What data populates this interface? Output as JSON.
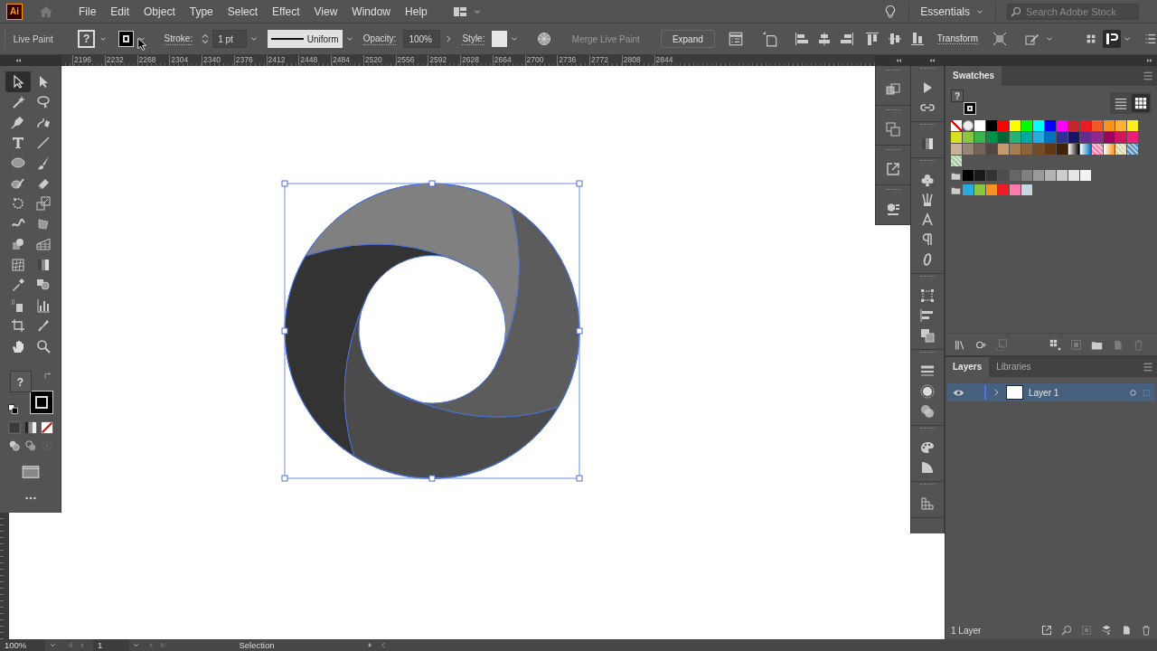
{
  "app_logo": "Ai",
  "menu": [
    "File",
    "Edit",
    "Object",
    "Type",
    "Select",
    "Effect",
    "View",
    "Window",
    "Help"
  ],
  "workspace": {
    "name": "Essentials"
  },
  "search": {
    "placeholder": "Search Adobe Stock"
  },
  "control_bar": {
    "mode": "Live Paint",
    "fill_label": "?",
    "stroke_label": "Stroke:",
    "stroke_weight": "1 pt",
    "stroke_profile": "Uniform",
    "opacity_label": "Opacity:",
    "opacity": "100%",
    "style_label": "Style:",
    "transform": "Transform",
    "buttons": [
      {
        "label": "Merge Live Paint",
        "disabled": true
      },
      {
        "label": "Expand",
        "disabled": false
      }
    ]
  },
  "ruler": {
    "ticks": [
      "2196",
      "2232",
      "2268",
      "2304",
      "2340",
      "2376",
      "2412",
      "2448",
      "2484",
      "2520",
      "2556",
      "2592",
      "2628",
      "2664",
      "2700",
      "2736",
      "2772",
      "2808",
      "2844"
    ]
  },
  "toolbar": {
    "fill_label": "?",
    "tools": [
      {
        "kind": "arrow",
        "selected": true
      },
      {
        "kind": "arrowfill",
        "selected": false
      },
      {
        "kind": "wand",
        "selected": false
      },
      {
        "kind": "lasso",
        "selected": false
      },
      {
        "kind": "pen",
        "selected": false
      },
      {
        "kind": "curvepen",
        "selected": false
      },
      {
        "kind": "type",
        "selected": false
      },
      {
        "kind": "line",
        "selected": false
      },
      {
        "kind": "ellipse",
        "selected": false
      },
      {
        "kind": "brush",
        "selected": false
      },
      {
        "kind": "shaper",
        "selected": false
      },
      {
        "kind": "eraser",
        "selected": false
      },
      {
        "kind": "rotate",
        "selected": false
      },
      {
        "kind": "scale",
        "selected": false
      },
      {
        "kind": "warp",
        "selected": false
      },
      {
        "kind": "freetransform",
        "selected": false
      },
      {
        "kind": "shapebuilder",
        "selected": false
      },
      {
        "kind": "perspective",
        "selected": false
      },
      {
        "kind": "mesh",
        "selected": false
      },
      {
        "kind": "gradient",
        "selected": false
      },
      {
        "kind": "eyedropper",
        "selected": false
      },
      {
        "kind": "blend",
        "selected": false
      },
      {
        "kind": "spray",
        "selected": false
      },
      {
        "kind": "graph",
        "selected": false
      },
      {
        "kind": "artboard",
        "selected": false
      },
      {
        "kind": "knife",
        "selected": false
      },
      {
        "kind": "hand",
        "selected": false
      },
      {
        "kind": "zoom",
        "selected": false
      }
    ]
  },
  "swatches_panel": {
    "title": "Swatches",
    "fill_label": "?",
    "views": [
      {
        "kind": "list",
        "selected": false
      },
      {
        "kind": "grid",
        "selected": true
      }
    ],
    "swatches": [
      {
        "kind": "none"
      },
      {
        "kind": "registration"
      },
      {
        "kind": "color",
        "color": "#ffffff"
      },
      {
        "kind": "color",
        "color": "#000000"
      },
      {
        "kind": "color",
        "color": "#ff0000"
      },
      {
        "kind": "color",
        "color": "#ffff00"
      },
      {
        "kind": "color",
        "color": "#00ff00"
      },
      {
        "kind": "color",
        "color": "#00ffff"
      },
      {
        "kind": "color",
        "color": "#0000ff"
      },
      {
        "kind": "color",
        "color": "#ff00ff"
      },
      {
        "kind": "color",
        "color": "#c1272d"
      },
      {
        "kind": "color",
        "color": "#ed1c24"
      },
      {
        "kind": "color",
        "color": "#f15a24"
      },
      {
        "kind": "color",
        "color": "#f7931e"
      },
      {
        "kind": "color",
        "color": "#fbb03b"
      },
      {
        "kind": "color",
        "color": "#fcee21"
      },
      {
        "kind": "color",
        "color": "#d9e021"
      },
      {
        "kind": "color",
        "color": "#8cc63f"
      },
      {
        "kind": "color",
        "color": "#39b54a"
      },
      {
        "kind": "color",
        "color": "#009245"
      },
      {
        "kind": "color",
        "color": "#006837"
      },
      {
        "kind": "color",
        "color": "#22b573"
      },
      {
        "kind": "color",
        "color": "#00a99d"
      },
      {
        "kind": "color",
        "color": "#29abe2"
      },
      {
        "kind": "color",
        "color": "#0071bc"
      },
      {
        "kind": "color",
        "color": "#2e3192"
      },
      {
        "kind": "color",
        "color": "#1b1464"
      },
      {
        "kind": "color",
        "color": "#662d91"
      },
      {
        "kind": "color",
        "color": "#93278f"
      },
      {
        "kind": "color",
        "color": "#9e005d"
      },
      {
        "kind": "color",
        "color": "#d4145a"
      },
      {
        "kind": "color",
        "color": "#ed1e79"
      },
      {
        "kind": "color",
        "color": "#c7b299"
      },
      {
        "kind": "color",
        "color": "#998675"
      },
      {
        "kind": "color",
        "color": "#736357"
      },
      {
        "kind": "color",
        "color": "#534741"
      },
      {
        "kind": "color",
        "color": "#c69c6d"
      },
      {
        "kind": "color",
        "color": "#a67c52"
      },
      {
        "kind": "color",
        "color": "#8c6239"
      },
      {
        "kind": "color",
        "color": "#754c24"
      },
      {
        "kind": "color",
        "color": "#603813"
      },
      {
        "kind": "color",
        "color": "#42210b"
      },
      {
        "kind": "gradient",
        "color": "#000000"
      },
      {
        "kind": "gradient",
        "color": "#0071bc"
      },
      {
        "kind": "pattern",
        "color": "#ff7bac"
      },
      {
        "kind": "gradient",
        "color": "#f7931e"
      },
      {
        "kind": "pattern",
        "color": "#d9d3a8"
      },
      {
        "kind": "pattern",
        "color": "#4a8fc2"
      },
      {
        "kind": "pattern",
        "color": "#9fc59a"
      }
    ],
    "groups": [
      {
        "swatches": [
          {
            "kind": "color",
            "color": "#000000"
          },
          {
            "kind": "color",
            "color": "#1a1a1a"
          },
          {
            "kind": "color",
            "color": "#333333"
          },
          {
            "kind": "color",
            "color": "#4d4d4d"
          },
          {
            "kind": "color",
            "color": "#666666"
          },
          {
            "kind": "color",
            "color": "#808080"
          },
          {
            "kind": "color",
            "color": "#999999"
          },
          {
            "kind": "color",
            "color": "#b3b3b3"
          },
          {
            "kind": "color",
            "color": "#cccccc"
          },
          {
            "kind": "color",
            "color": "#e6e6e6"
          },
          {
            "kind": "color",
            "color": "#f2f2f2"
          }
        ]
      },
      {
        "swatches": [
          {
            "kind": "color",
            "color": "#29abe2"
          },
          {
            "kind": "color",
            "color": "#8cc63f"
          },
          {
            "kind": "color",
            "color": "#f7931e"
          },
          {
            "kind": "color",
            "color": "#ed1c24"
          },
          {
            "kind": "color",
            "color": "#ff7bac"
          },
          {
            "kind": "color",
            "color": "#c8d6e0"
          }
        ]
      }
    ],
    "footer_tools": [
      {
        "kind": "library",
        "disabled": false
      },
      {
        "kind": "swatchkind",
        "disabled": false
      },
      {
        "kind": "import",
        "disabled": true
      },
      {
        "kind": "colorgroup",
        "disabled": false
      },
      {
        "kind": "swatchopts",
        "disabled": true
      },
      {
        "kind": "folder",
        "disabled": false
      },
      {
        "kind": "newpage",
        "disabled": true
      },
      {
        "kind": "trash",
        "disabled": true
      }
    ]
  },
  "layers_panel": {
    "tabs": [
      {
        "label": "Layers",
        "selected": true
      },
      {
        "label": "Libraries",
        "selected": false
      }
    ],
    "layers": [
      {
        "name": "Layer 1",
        "visible": true,
        "expanded": false,
        "selected": true,
        "color": "#4f6ff0"
      }
    ],
    "count": "1 Layer",
    "footer_tools": [
      {
        "kind": "export",
        "disabled": false
      },
      {
        "kind": "search",
        "disabled": false
      },
      {
        "kind": "clip",
        "disabled": true
      },
      {
        "kind": "sublayer",
        "disabled": false
      },
      {
        "kind": "newpage",
        "disabled": false
      },
      {
        "kind": "trash",
        "disabled": false
      }
    ]
  },
  "status_bar": {
    "zoom": "100%",
    "artboard": "1",
    "tool": "Selection",
    "nav": [
      {
        "kind": "first",
        "disabled": true
      },
      {
        "kind": "prev",
        "disabled": true
      },
      {
        "kind": "next",
        "disabled": true
      },
      {
        "kind": "last",
        "disabled": true
      }
    ]
  }
}
